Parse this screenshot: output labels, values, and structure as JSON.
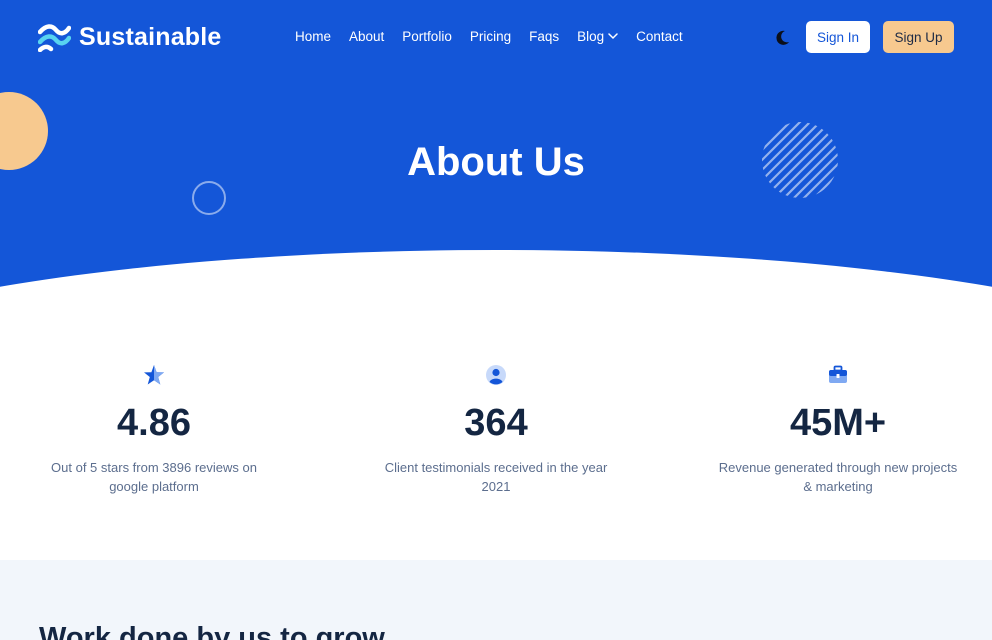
{
  "brand": {
    "name": "Sustainable"
  },
  "nav": {
    "items": [
      {
        "label": "Home"
      },
      {
        "label": "About"
      },
      {
        "label": "Portfolio"
      },
      {
        "label": "Pricing"
      },
      {
        "label": "Faqs"
      },
      {
        "label": "Blog"
      },
      {
        "label": "Contact"
      }
    ],
    "theme_icon": "moon-icon",
    "signin_label": "Sign In",
    "signup_label": "Sign Up"
  },
  "hero": {
    "title": "About Us"
  },
  "stats": [
    {
      "icon": "star-icon",
      "value": "4.86",
      "description": "Out of 5 stars from 3896 reviews on google platform"
    },
    {
      "icon": "user-icon",
      "value": "364",
      "description": "Client testimonials received in the year 2021"
    },
    {
      "icon": "briefcase-icon",
      "value": "45M+",
      "description": "Revenue generated through new projects & marketing"
    }
  ],
  "section": {
    "heading": "Work done by us to grow"
  },
  "colors": {
    "primary": "#1456d8",
    "accent": "#f7c98f",
    "heading": "#142642",
    "muted": "#5c6e8e",
    "section_bg": "#f2f6fb"
  }
}
